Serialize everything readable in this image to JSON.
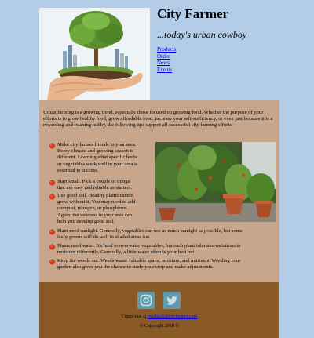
{
  "header": {
    "title": "City Farmer",
    "tagline": "...today's urban cowboy",
    "nav": [
      "Products",
      "Order",
      "News",
      "Events"
    ]
  },
  "content": {
    "intro": "Urban farming is a growing trend, especially those focused on growing food. Whether the purpose of your efforts is to grow healthy food, grow affordable food, increase your self-sufficiency, or even just because it is a rewarding and relaxing hobby, the following tips support all successful city farming efforts.",
    "tips": [
      {
        "lines": [
          "Make city farmer friends in your area.",
          "Every climate and growing season is",
          "different. Learning what specific herbs",
          "or vegetables work well in your area is",
          "essential to success."
        ]
      },
      {
        "lines": [
          "Start small. Pick a couple of things",
          "that are easy and reliable as starters."
        ]
      },
      {
        "lines": [
          "Use good soil. Healthy plants cannot",
          "grow without it. You may need to add",
          "compost, nitrogen, or phosphorus.",
          "Again, the veterans in your area can",
          "help you develop good soil."
        ]
      },
      {
        "lines": [
          "Plant need sunlight. Generally, vegetables can use as much sunlight as possible, but some",
          "leafy greens will do well in shaded areas too."
        ]
      },
      {
        "lines": [
          "Plants need water. It's hard to overwater vegetables, but each plant tolerates variations in",
          "moisture differently. Generally, a little water often is your best bet."
        ]
      },
      {
        "lines": [
          "Keep the weeds out. Weeds waste valuable space, moisture, and nutrients. Weeding your",
          "garden also gives you the chance to study your crop and make adjustments."
        ]
      }
    ]
  },
  "footer": {
    "contact_prefix": "Contact us at",
    "contact_email": "feedback@cityfarmer.com",
    "copyright": "© Copyright 2018 ©"
  },
  "colors": {
    "background": "#b3cde8",
    "content_bg": "#c8a68b",
    "footer_bg": "#8a5a27",
    "social_icons": "#5f9bab",
    "link": "#0000ee"
  }
}
